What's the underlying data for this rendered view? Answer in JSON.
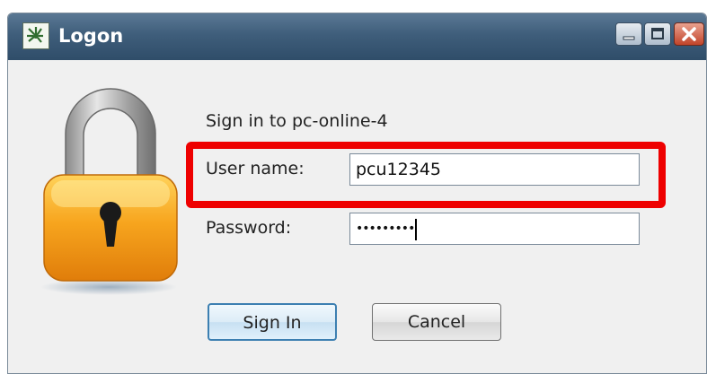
{
  "window": {
    "title": "Logon"
  },
  "form": {
    "prompt": "Sign in to pc-online-4",
    "username_label": "User name:",
    "username_value": "pcu12345",
    "password_label": "Password:",
    "password_masked": "•••••••••"
  },
  "buttons": {
    "sign_in": "Sign In",
    "cancel": "Cancel"
  },
  "icons": {
    "app": "logon-app-icon",
    "lock": "padlock-icon",
    "minimize": "minimize-icon",
    "maximize": "maximize-icon",
    "close": "close-icon"
  },
  "colors": {
    "titlebar": "#3f5e7b",
    "highlight": "#ee0000",
    "lock_body": "#f5a623"
  }
}
